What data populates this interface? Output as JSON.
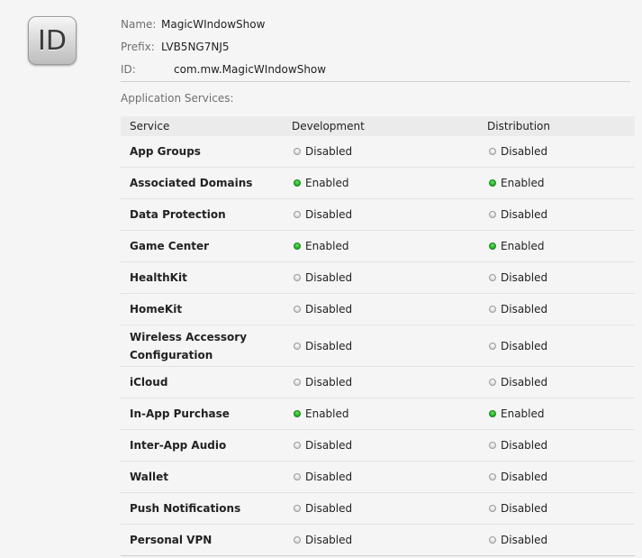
{
  "icon": {
    "text": "ID"
  },
  "info": {
    "name_label": "Name:",
    "name_value": "MagicWIndowShow",
    "prefix_label": "Prefix:",
    "prefix_value": "LVB5NG7NJ5",
    "id_label": "ID:",
    "id_value": "com.mw.MagicWIndowShow"
  },
  "section_title": "Application Services:",
  "table": {
    "headers": {
      "service": "Service",
      "development": "Development",
      "distribution": "Distribution"
    },
    "rows": [
      {
        "service": "App Groups",
        "development": "Disabled",
        "distribution": "Disabled",
        "dev_on": false,
        "dist_on": false
      },
      {
        "service": "Associated Domains",
        "development": "Enabled",
        "distribution": "Enabled",
        "dev_on": true,
        "dist_on": true
      },
      {
        "service": "Data Protection",
        "development": "Disabled",
        "distribution": "Disabled",
        "dev_on": false,
        "dist_on": false
      },
      {
        "service": "Game Center",
        "development": "Enabled",
        "distribution": "Enabled",
        "dev_on": true,
        "dist_on": true
      },
      {
        "service": "HealthKit",
        "development": "Disabled",
        "distribution": "Disabled",
        "dev_on": false,
        "dist_on": false
      },
      {
        "service": "HomeKit",
        "development": "Disabled",
        "distribution": "Disabled",
        "dev_on": false,
        "dist_on": false
      },
      {
        "service": "Wireless Accessory Configuration",
        "development": "Disabled",
        "distribution": "Disabled",
        "dev_on": false,
        "dist_on": false
      },
      {
        "service": "iCloud",
        "development": "Disabled",
        "distribution": "Disabled",
        "dev_on": false,
        "dist_on": false
      },
      {
        "service": "In-App Purchase",
        "development": "Enabled",
        "distribution": "Enabled",
        "dev_on": true,
        "dist_on": true
      },
      {
        "service": "Inter-App Audio",
        "development": "Disabled",
        "distribution": "Disabled",
        "dev_on": false,
        "dist_on": false
      },
      {
        "service": "Wallet",
        "development": "Disabled",
        "distribution": "Disabled",
        "dev_on": false,
        "dist_on": false
      },
      {
        "service": "Push Notifications",
        "development": "Disabled",
        "distribution": "Disabled",
        "dev_on": false,
        "dist_on": false
      },
      {
        "service": "Personal VPN",
        "development": "Disabled",
        "distribution": "Disabled",
        "dev_on": false,
        "dist_on": false
      }
    ]
  },
  "colors": {
    "enabled": "#25b427",
    "disabled": "#d0d0d0"
  }
}
